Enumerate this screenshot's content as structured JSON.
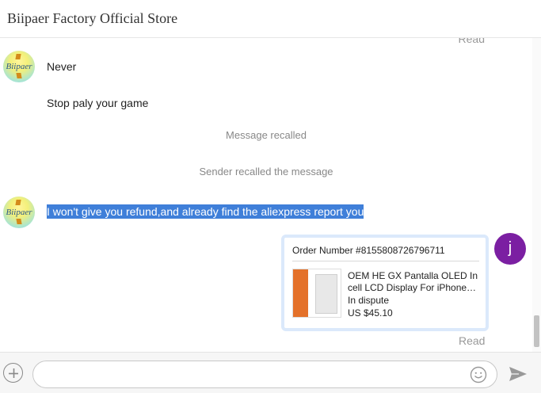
{
  "header": {
    "title": "Biipaer Factory Official Store"
  },
  "chat": {
    "read_top": "Read",
    "seller_avatar_text": "Biipaer",
    "messages": [
      {
        "text": "Never"
      },
      {
        "text": "Stop paly your game"
      },
      {
        "text": "Message recalled"
      },
      {
        "text": "Sender recalled the message"
      },
      {
        "text": "I won't give you refund,and already find the aliexpress report you"
      }
    ],
    "order": {
      "number_label": "Order Number #8155808726796711",
      "product_title": "OEM HE GX Pantalla OLED In cell LCD Display For iPhone…",
      "status": "In dispute",
      "price": "US $45.10"
    },
    "user_avatar_letter": "j",
    "read_bottom": "Read"
  },
  "composer": {
    "placeholder": ""
  },
  "colors": {
    "user_avatar": "#7b1fa2",
    "highlight": "#3f7fd9",
    "card_border": "#dbe9fb"
  }
}
